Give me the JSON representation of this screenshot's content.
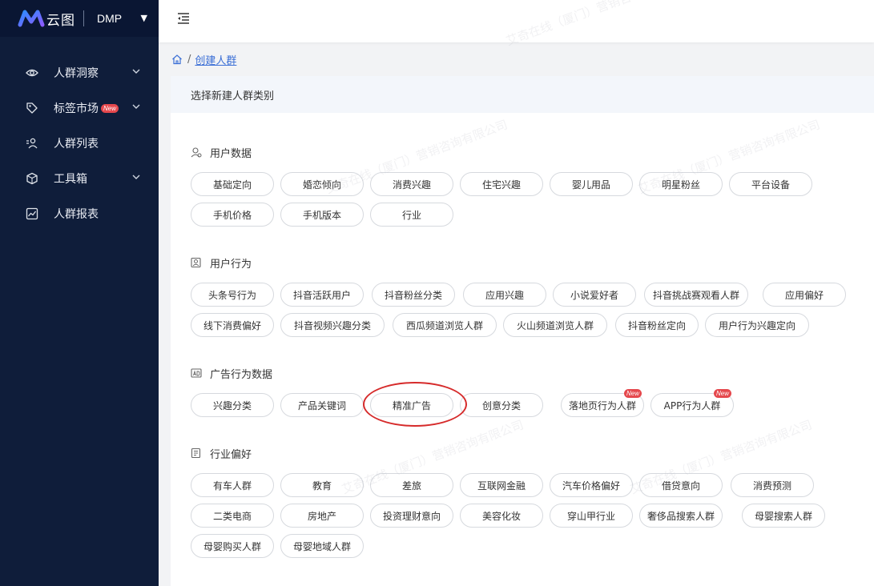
{
  "brand": {
    "logo_text": "云图",
    "product": "DMP"
  },
  "sidebar": {
    "items": [
      {
        "label": "人群洞察",
        "badge": "",
        "has_children": true
      },
      {
        "label": "标签市场",
        "badge": "New",
        "has_children": true
      },
      {
        "label": "人群列表",
        "badge": "",
        "has_children": false
      },
      {
        "label": "工具箱",
        "badge": "",
        "has_children": true
      },
      {
        "label": "人群报表",
        "badge": "",
        "has_children": false
      }
    ]
  },
  "breadcrumb": {
    "separator": "/",
    "current": "创建人群"
  },
  "main": {
    "heading": "选择新建人群类别"
  },
  "sections": [
    {
      "title": "用户数据",
      "tags": [
        "基础定向",
        "婚恋倾向",
        "消费兴趣",
        "住宅兴趣",
        "婴儿用品",
        "明星粉丝",
        "平台设备",
        "手机价格",
        "手机版本",
        "行业"
      ]
    },
    {
      "title": "用户行为",
      "tags": [
        "头条号行为",
        "抖音活跃用户",
        "抖音粉丝分类",
        "应用兴趣",
        "小说爱好者",
        "抖音挑战赛观看人群",
        "应用偏好",
        "线下消费偏好",
        "抖音视频兴趣分类",
        "西瓜频道浏览人群",
        "火山频道浏览人群",
        "抖音粉丝定向",
        "用户行为兴趣定向"
      ]
    },
    {
      "title": "广告行为数据",
      "tags": [
        "兴趣分类",
        "产品关键词",
        "精准广告",
        "创意分类",
        "落地页行为人群",
        "APP行为人群"
      ],
      "new_badge": "New"
    },
    {
      "title": "行业偏好",
      "tags": [
        "有车人群",
        "教育",
        "差旅",
        "互联网金融",
        "汽车价格偏好",
        "借贷意向",
        "消费预测",
        "二类电商",
        "房地产",
        "投资理财意向",
        "美容化妆",
        "穿山甲行业",
        "奢侈品搜索人群",
        "母婴搜索人群",
        "母婴购买人群",
        "母婴地域人群"
      ]
    }
  ],
  "watermark": "艾奇在线（厦门）营销咨询有限公司",
  "colors": {
    "sidebar_bg": "#0f1d3a",
    "brand_bg": "#0a1633",
    "accent": "#3b6fd6",
    "badge": "#e5484d",
    "highlight": "#d62b2b"
  }
}
